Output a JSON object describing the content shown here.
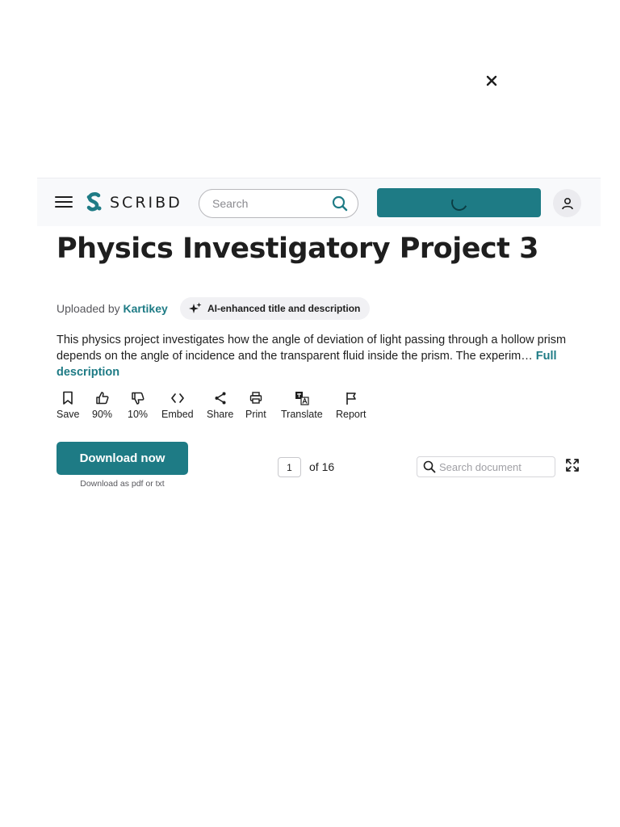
{
  "topbar": {
    "logo_text": "SCRIBD",
    "search_placeholder": "Search"
  },
  "document": {
    "title": "Physics Investigatory Project 3",
    "uploaded_by_label": "Uploaded by",
    "uploader": "Kartikey",
    "ai_badge": "AI-enhanced title and description",
    "description": "This physics project investigates how the angle of deviation of light passing through a hollow prism depends on the angle of incidence and the transparent fluid inside the prism. The experim…",
    "full_description_link": "Full description"
  },
  "actions": {
    "save": "Save",
    "like_percent": "90%",
    "dislike_percent": "10%",
    "embed": "Embed",
    "share": "Share",
    "print": "Print",
    "translate": "Translate",
    "report": "Report"
  },
  "download": {
    "button_label": "Download now",
    "subtext": "Download as pdf or txt"
  },
  "viewer": {
    "page_number": "1",
    "total_pages_label": "of 16",
    "search_placeholder": "Search document"
  },
  "colors": {
    "accent": "#1e7b85",
    "text": "#1e1e1e"
  }
}
